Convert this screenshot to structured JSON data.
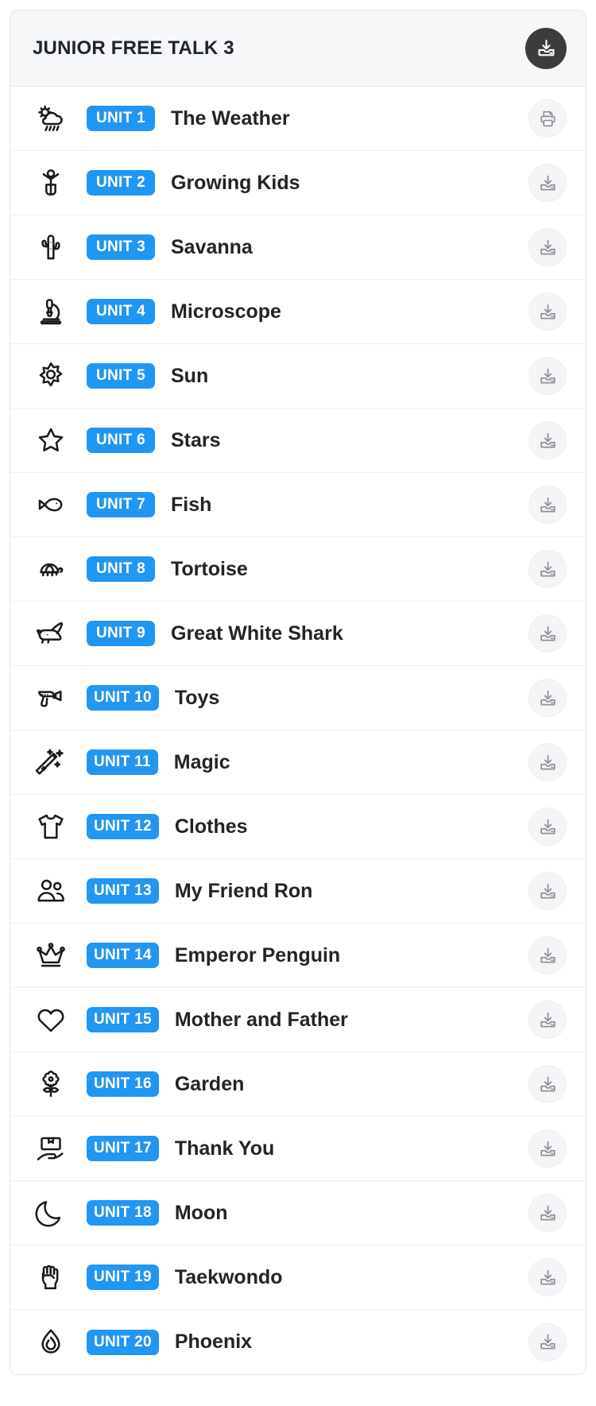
{
  "header": {
    "title": "JUNIOR FREE TALK 3",
    "download_all_icon": "download-tray-icon"
  },
  "units": [
    {
      "badge": "UNIT 1",
      "name": "The Weather",
      "icon": "weather-sun-cloud-rain-icon",
      "action_icon": "printer-icon"
    },
    {
      "badge": "UNIT 2",
      "name": "Growing Kids",
      "icon": "child-person-icon",
      "action_icon": "download-tray-icon"
    },
    {
      "badge": "UNIT 3",
      "name": "Savanna",
      "icon": "cactus-icon",
      "action_icon": "download-tray-icon"
    },
    {
      "badge": "UNIT 4",
      "name": "Microscope",
      "icon": "microscope-icon",
      "action_icon": "download-tray-icon"
    },
    {
      "badge": "UNIT 5",
      "name": "Sun",
      "icon": "sun-icon",
      "action_icon": "download-tray-icon"
    },
    {
      "badge": "UNIT 6",
      "name": "Stars",
      "icon": "star-icon",
      "action_icon": "download-tray-icon"
    },
    {
      "badge": "UNIT 7",
      "name": "Fish",
      "icon": "fish-icon",
      "action_icon": "download-tray-icon"
    },
    {
      "badge": "UNIT 8",
      "name": "Tortoise",
      "icon": "tortoise-icon",
      "action_icon": "download-tray-icon"
    },
    {
      "badge": "UNIT 9",
      "name": "Great White Shark",
      "icon": "whale-shark-icon",
      "action_icon": "download-tray-icon"
    },
    {
      "badge": "UNIT 10",
      "name": "Toys",
      "icon": "ray-gun-toy-icon",
      "action_icon": "download-tray-icon"
    },
    {
      "badge": "UNIT 11",
      "name": "Magic",
      "icon": "magic-wand-icon",
      "action_icon": "download-tray-icon"
    },
    {
      "badge": "UNIT 12",
      "name": "Clothes",
      "icon": "tshirt-icon",
      "action_icon": "download-tray-icon"
    },
    {
      "badge": "UNIT 13",
      "name": "My Friend Ron",
      "icon": "two-people-icon",
      "action_icon": "download-tray-icon"
    },
    {
      "badge": "UNIT 14",
      "name": "Emperor Penguin",
      "icon": "crown-icon",
      "action_icon": "download-tray-icon"
    },
    {
      "badge": "UNIT 15",
      "name": "Mother and Father",
      "icon": "heart-icon",
      "action_icon": "download-tray-icon"
    },
    {
      "badge": "UNIT 16",
      "name": "Garden",
      "icon": "flower-icon",
      "action_icon": "download-tray-icon"
    },
    {
      "badge": "UNIT 17",
      "name": "Thank You",
      "icon": "gift-on-hand-icon",
      "action_icon": "download-tray-icon"
    },
    {
      "badge": "UNIT 18",
      "name": "Moon",
      "icon": "moon-crescent-icon",
      "action_icon": "download-tray-icon"
    },
    {
      "badge": "UNIT 19",
      "name": "Taekwondo",
      "icon": "fist-icon",
      "action_icon": "download-tray-icon"
    },
    {
      "badge": "UNIT 20",
      "name": "Phoenix",
      "icon": "flame-drop-icon",
      "action_icon": "download-tray-icon"
    }
  ],
  "colors": {
    "badge_blue": "#2196f3",
    "header_bg": "#f6f7f9",
    "header_button_bg": "#3c3c3c",
    "row_action_bg": "#f4f5f7",
    "text": "#222428"
  }
}
